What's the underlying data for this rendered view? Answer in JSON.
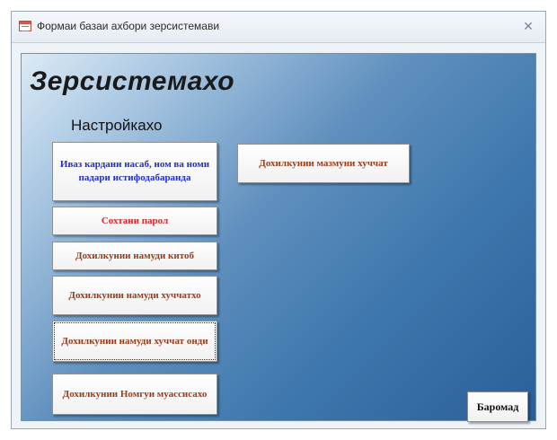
{
  "window": {
    "title": "Формаи базаи ахбори зерсистемави",
    "close_glyph": "✕"
  },
  "form": {
    "app_title": "Зерсистемахо",
    "section_title": "Настройкахо",
    "buttons": {
      "change_user": "Иваз кардани насаб, ном ва номи падари истифодабаранда",
      "create_password": "Сохтани парол",
      "enter_book_sample": "Дохилкунии намуди китоб",
      "enter_document_sample": "Дохилкунии намуди хуччатхо",
      "enter_document_sample_other": "Дохилкунии намуди хуччат онди",
      "enter_institution_name": "Дохилкунии Номгуи муассисахо",
      "enter_document_content": "Дохилкунии мазмуни хуччат",
      "exit": "Баромад"
    }
  }
}
